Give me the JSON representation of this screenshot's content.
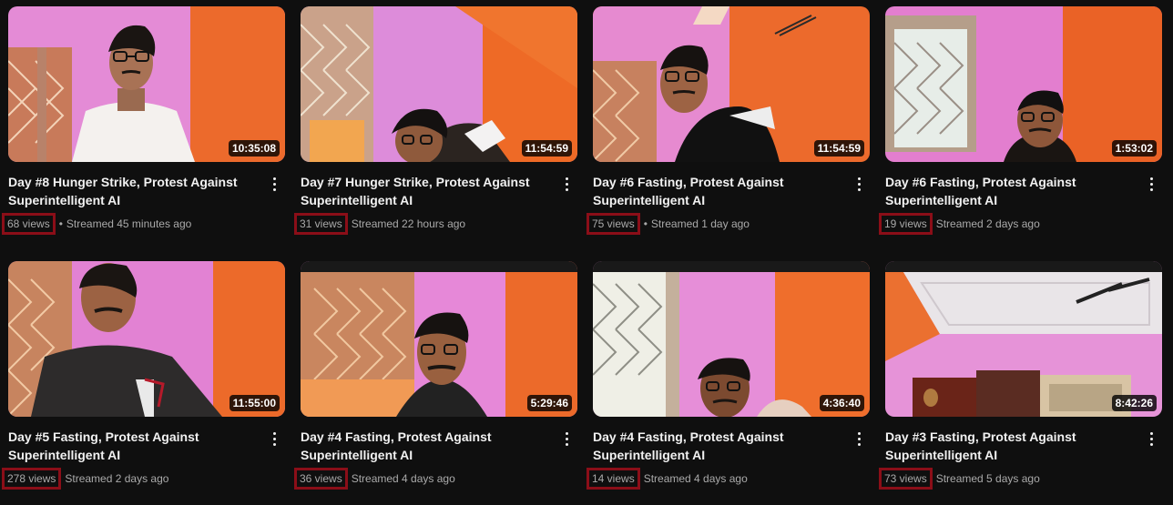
{
  "videos": [
    {
      "title_line1": "Day #8 Hunger Strike, Protest Against",
      "title_line2": "Superintelligent AI",
      "duration": "10:35:08",
      "views": "68 views",
      "separator": "•",
      "streamed": "Streamed 45 minutes ago",
      "thumb_icon": "man-sitting-pink-wall-thumbnail"
    },
    {
      "title_line1": "Day #7 Hunger Strike, Protest Against",
      "title_line2": "Superintelligent AI",
      "duration": "11:54:59",
      "views": "31 views",
      "separator": "",
      "streamed": "Streamed 22 hours ago",
      "thumb_icon": "man-lying-down-thumbnail"
    },
    {
      "title_line1": "Day #6 Fasting, Protest Against",
      "title_line2": "Superintelligent AI",
      "duration": "11:54:59",
      "views": "75 views",
      "separator": "•",
      "streamed": "Streamed 1 day ago",
      "thumb_icon": "man-sitting-orange-wall-thumbnail"
    },
    {
      "title_line1": "Day #6 Fasting, Protest Against",
      "title_line2": "Superintelligent AI",
      "duration": "1:53:02",
      "views": "19 views",
      "separator": "",
      "streamed": "Streamed 2 days ago",
      "thumb_icon": "man-near-window-thumbnail"
    },
    {
      "title_line1": "Day #5 Fasting, Protest Against",
      "title_line2": "Superintelligent AI",
      "duration": "11:55:00",
      "views": "278 views",
      "separator": "",
      "streamed": "Streamed 2 days ago",
      "thumb_icon": "man-black-tshirt-thumbnail"
    },
    {
      "title_line1": "Day #4 Fasting, Protest Against",
      "title_line2": "Superintelligent AI",
      "duration": "5:29:46",
      "views": "36 views",
      "separator": "",
      "streamed": "Streamed 4 days ago",
      "thumb_icon": "man-center-frame-thumbnail"
    },
    {
      "title_line1": "Day #4 Fasting, Protest Against",
      "title_line2": "Superintelligent AI",
      "duration": "4:36:40",
      "views": "14 views",
      "separator": "",
      "streamed": "Streamed 4 days ago",
      "thumb_icon": "man-bottom-frame-thumbnail"
    },
    {
      "title_line1": "Day #3 Fasting, Protest Against",
      "title_line2": "Superintelligent AI",
      "duration": "8:42:26",
      "views": "73 views",
      "separator": "",
      "streamed": "Streamed 5 days ago",
      "thumb_icon": "room-ceiling-fan-thumbnail"
    }
  ],
  "colors": {
    "background": "#0f0f0f",
    "pink_wall": "#e07fd0",
    "orange_wall": "#ec6a2c",
    "highlight_box": "#8b0e18",
    "meta_text": "#aaaaaa"
  }
}
